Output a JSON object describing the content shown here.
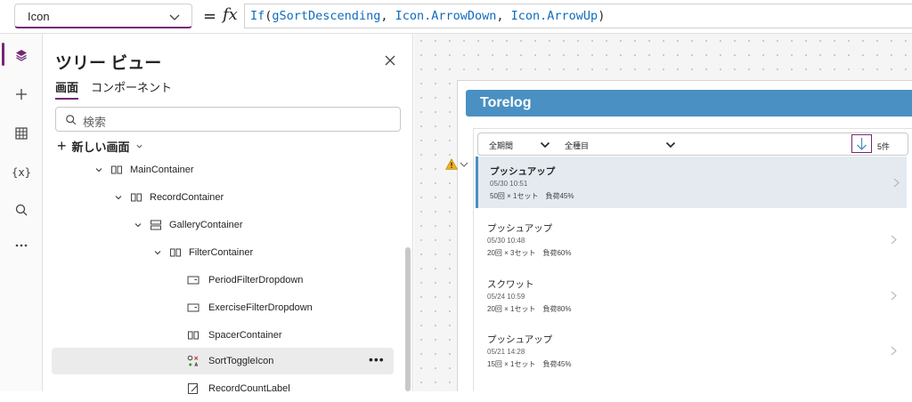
{
  "formula_bar": {
    "property": "Icon",
    "equals": "=",
    "fx": "fx",
    "formula": {
      "fn": "If",
      "open": "(",
      "arg1": "gSortDescending",
      "sep1": ", ",
      "arg2": "Icon.ArrowDown",
      "sep2": ", ",
      "arg3": "Icon.ArrowUp",
      "close": ")"
    }
  },
  "rail": {
    "icons": [
      "layers-icon",
      "plus-icon",
      "table-icon",
      "variables-icon",
      "search-icon",
      "more-icon"
    ],
    "variables_label": "{x}"
  },
  "tree": {
    "title": "ツリー ビュー",
    "tabs": [
      "画面",
      "コンポーネント"
    ],
    "search_placeholder": "検索",
    "new_screen": "新しい画面",
    "items": [
      {
        "label": "MainContainer",
        "icon": "container-icon",
        "expanded": true
      },
      {
        "label": "RecordContainer",
        "icon": "container-icon",
        "expanded": true
      },
      {
        "label": "GalleryContainer",
        "icon": "gallery-icon",
        "expanded": true
      },
      {
        "label": "FilterContainer",
        "icon": "container-icon",
        "expanded": true
      },
      {
        "label": "PeriodFilterDropdown",
        "icon": "dropdown-icon"
      },
      {
        "label": "ExerciseFilterDropdown",
        "icon": "dropdown-icon"
      },
      {
        "label": "SpacerContainer",
        "icon": "container-icon"
      },
      {
        "label": "SortToggleIcon",
        "icon": "icon-control-icon",
        "selected": true
      },
      {
        "label": "RecordCountLabel",
        "icon": "label-icon"
      }
    ],
    "more": "•••"
  },
  "app": {
    "title": "Torelog",
    "filters": {
      "period": "全期間",
      "exercise": "全種目",
      "count": "5件"
    },
    "records": [
      {
        "title": "プッシュアップ",
        "date": "05/30 10:51",
        "detail": "50回 × 1セット　負荷45%",
        "selected": true
      },
      {
        "title": "プッシュアップ",
        "date": "05/30 10:48",
        "detail": "20回 × 3セット　負荷60%"
      },
      {
        "title": "スクワット",
        "date": "05/24 10:59",
        "detail": "20回 × 1セット　負荷80%"
      },
      {
        "title": "プッシュアップ",
        "date": "05/21 14:28",
        "detail": "15回 × 1セット　負荷45%"
      }
    ]
  },
  "colors": {
    "accent": "#742774",
    "app_header": "#4a90c2",
    "formula_fn": "#0f6cbd"
  }
}
